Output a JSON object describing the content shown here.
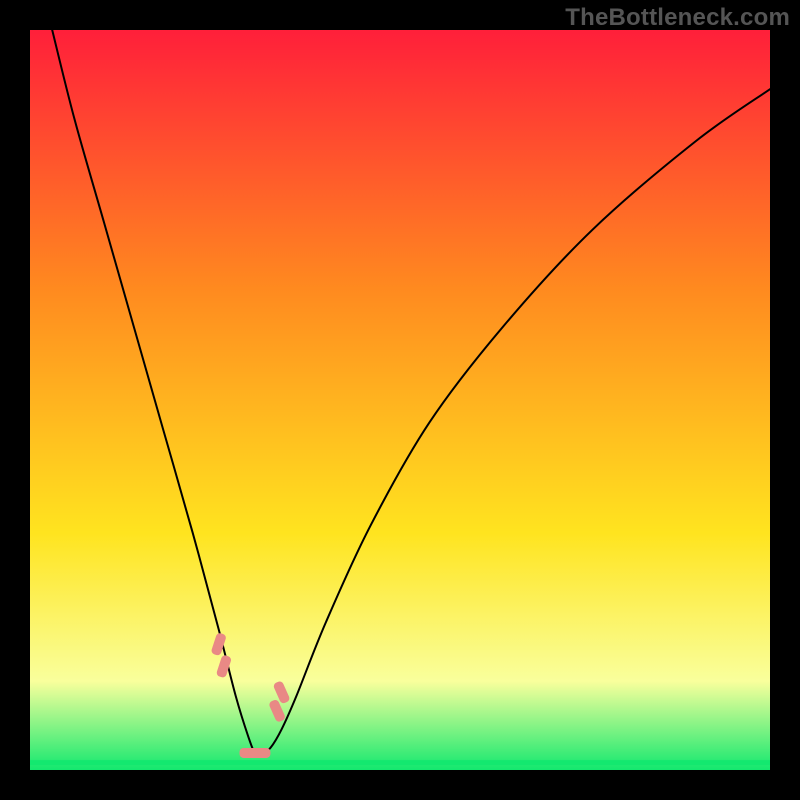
{
  "watermark": "TheBottleneck.com",
  "chart_data": {
    "type": "line",
    "title": "",
    "xlabel": "",
    "ylabel": "",
    "xlim": [
      0,
      100
    ],
    "ylim": [
      0,
      100
    ],
    "background_gradient": {
      "top": "#ff1f3a",
      "mid1": "#ff8a1f",
      "mid2": "#ffe41f",
      "lower": "#f9ff9c",
      "bottom": "#13e86f"
    },
    "series": [
      {
        "name": "bottleneck-curve",
        "x": [
          3,
          6,
          10,
          14,
          18,
          22,
          25.5,
          27.8,
          29.5,
          30.5,
          31.2,
          32.5,
          34,
          36,
          40,
          46,
          54,
          64,
          76,
          90,
          100
        ],
        "y": [
          100,
          88,
          74,
          60,
          46,
          32,
          19,
          10,
          4.5,
          2.0,
          2.0,
          3.0,
          5.5,
          10,
          20,
          33,
          47,
          60,
          73,
          85,
          92
        ]
      }
    ],
    "baseline_y": 1.0,
    "markers": [
      {
        "x": 25.5,
        "y": 17,
        "angle": -72
      },
      {
        "x": 26.2,
        "y": 14,
        "angle": -72
      },
      {
        "x": 29.8,
        "y": 2.3,
        "angle": 0
      },
      {
        "x": 31.0,
        "y": 2.3,
        "angle": 0
      },
      {
        "x": 33.4,
        "y": 8.0,
        "angle": 66
      },
      {
        "x": 34.0,
        "y": 10.5,
        "angle": 66
      }
    ],
    "marker_shape": {
      "rx": 11,
      "ry": 5,
      "corner_r": 4
    }
  }
}
